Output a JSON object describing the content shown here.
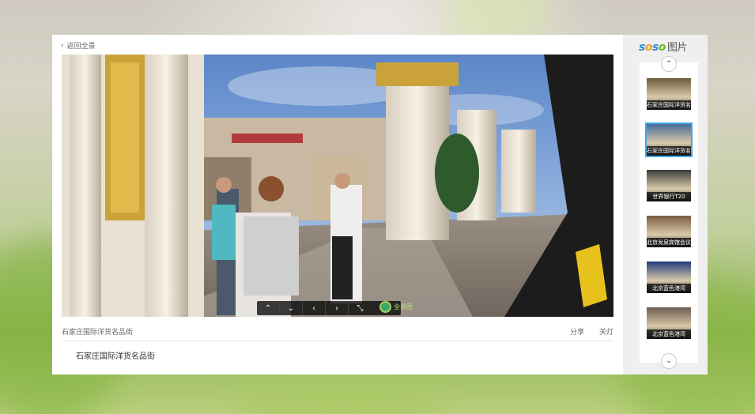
{
  "header": {
    "back_label": "返回全景"
  },
  "brand": {
    "s1": "s",
    "o1": "o",
    "s2": "s",
    "o2": "o",
    "suffix": "图片"
  },
  "photo": {
    "controls": [
      {
        "name": "pan-up-button",
        "glyph": "⌃"
      },
      {
        "name": "pan-down-button",
        "glyph": "⌄"
      },
      {
        "name": "pan-left-button",
        "glyph": "‹"
      },
      {
        "name": "pan-right-button",
        "glyph": "›"
      },
      {
        "name": "fullscreen-button",
        "glyph": "⤡"
      }
    ],
    "badge_text": "全景图"
  },
  "caption": {
    "title": "石家庄国际洋货名品街",
    "share_label": "分享",
    "light_off_label": "关灯",
    "description": "石家庄国际洋货名品街"
  },
  "sidebar": {
    "up_glyph": "⌃",
    "down_glyph": "⌄",
    "thumbnails": [
      {
        "label": "石家庄国际洋货名",
        "selected": false,
        "tint": "#6b5a3a"
      },
      {
        "label": "石家庄国际洋货名",
        "selected": true,
        "tint": "#4a6a9a"
      },
      {
        "label": "世界银行T20",
        "selected": false,
        "tint": "#3a3a3a"
      },
      {
        "label": "北京龙泉宾馆会议",
        "selected": false,
        "tint": "#7a5a40"
      },
      {
        "label": "北京蓝色港湾",
        "selected": false,
        "tint": "#233a7a"
      },
      {
        "label": "北京蓝色港湾",
        "selected": false,
        "tint": "#6a5a50"
      }
    ]
  },
  "colors": {
    "accent": "#3fa9e6",
    "background": "#8fb651"
  }
}
